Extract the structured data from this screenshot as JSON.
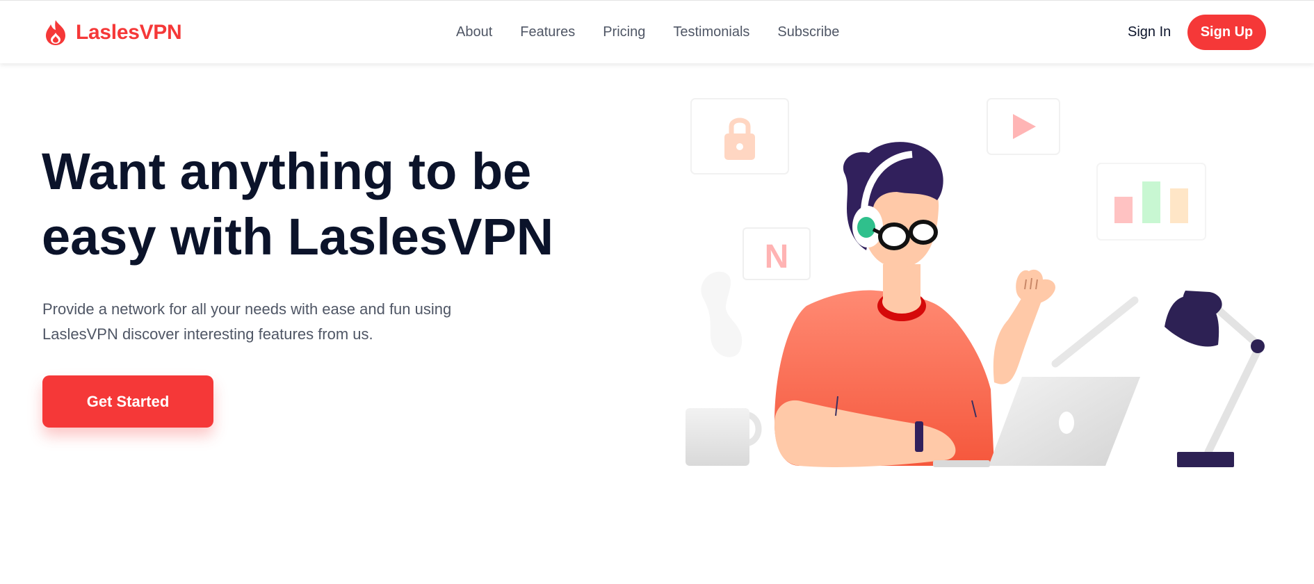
{
  "brand": {
    "name": "LaslesVPN",
    "color": "#f53838",
    "icon": "flame-logo-icon"
  },
  "nav": {
    "items": [
      "About",
      "Features",
      "Pricing",
      "Testimonials",
      "Subscribe"
    ]
  },
  "auth": {
    "signin_label": "Sign In",
    "signup_label": "Sign Up"
  },
  "hero": {
    "title_line1": "Want anything to be",
    "title_line2": "easy with LaslesVPN",
    "desc_line1": "Provide a network for all your needs with ease and fun using",
    "desc_line2": "LaslesVPN discover interesting features from us.",
    "cta_label": "Get Started"
  },
  "illustration": {
    "netflix_letter": "N",
    "icons": [
      "lock-icon",
      "play-icon",
      "bar-chart-icon",
      "netflix-icon",
      "coffee-mug-icon",
      "desk-lamp-icon",
      "laptop-icon"
    ]
  },
  "colors": {
    "accent": "#f53838",
    "heading": "#0b132a",
    "body": "#4f5665"
  }
}
